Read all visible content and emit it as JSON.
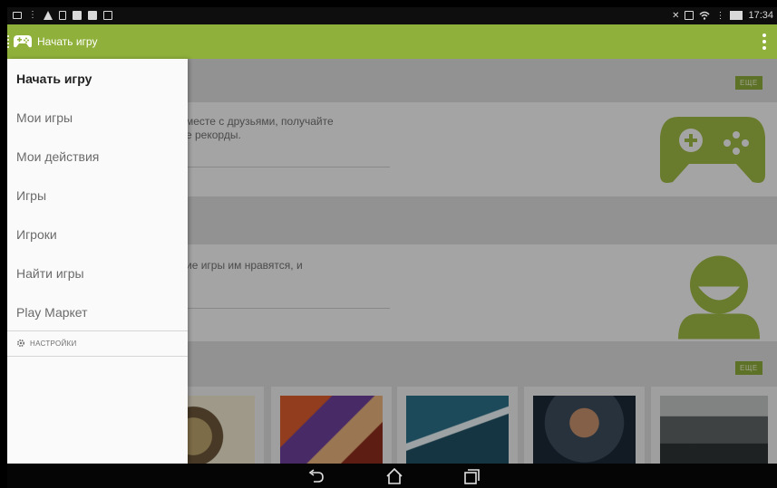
{
  "status_bar": {
    "time": "17:34",
    "left_icons": [
      "screen-icon",
      "dots-icon",
      "warning-icon",
      "file-icon",
      "image-icon",
      "image-icon",
      "camera-icon"
    ],
    "right_icons": [
      "mute-icon",
      "vibrate-icon",
      "wifi-icon",
      "battery-icon"
    ]
  },
  "action_bar": {
    "title": "Начать игру",
    "logo_icon": "gamepad-icon",
    "overflow_icon": "overflow-menu-icon",
    "accent_color": "#8fb03a"
  },
  "drawer": {
    "items": [
      {
        "label": "Начать игру",
        "active": true
      },
      {
        "label": "Мои игры",
        "active": false
      },
      {
        "label": "Мои действия",
        "active": false
      },
      {
        "label": "Игры",
        "active": false
      },
      {
        "label": "Игроки",
        "active": false
      },
      {
        "label": "Найти игры",
        "active": false
      },
      {
        "label": "Play Маркет",
        "active": false
      }
    ],
    "settings_label": "НАСТРОЙКИ",
    "settings_icon": "gear-icon"
  },
  "content": {
    "card1_text": "месте с друзьями, получайте\nе рекорды.",
    "card2_text": "ие игры им нравятся, и",
    "badge_label": "ЕЩЕ"
  },
  "nav_bar": {
    "buttons": [
      "back-icon",
      "home-icon",
      "recent-apps-icon"
    ]
  }
}
